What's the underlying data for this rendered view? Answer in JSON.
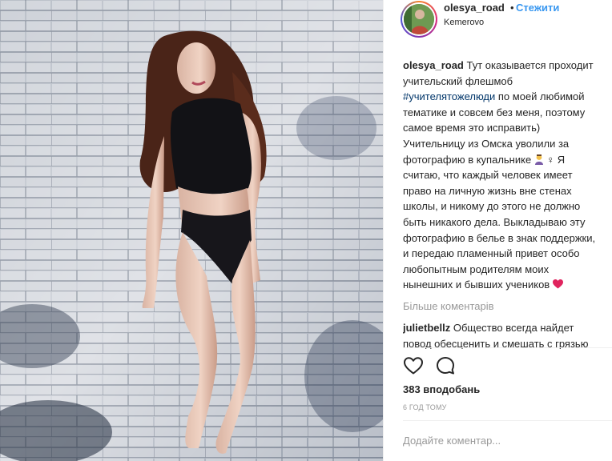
{
  "post": {
    "username": "olesya_road",
    "follow_label": "Стежити",
    "separator": "•",
    "location": "Kemerovo",
    "caption_user": "olesya_road",
    "caption_part1": " Тут оказывается проходит учительский флешмоб ",
    "caption_hashtag": "#учителятожелюди",
    "caption_part2": " по моей любимой тематике и совсем без меня, поэтому самое время это исправить) Учительницу из Омска уволили за фотографию в купальнике ",
    "caption_part3": " Я считаю, что каждый человек имеет право на личную жизнь вне стенах школы, и никому до этого не должно быть никакого дела. Выкладываю эту фотографию в белье в знак поддержки, и передаю пламенный привет особо любопытным родителям моих нынешних и бывших учеников ",
    "more_comments_label": "Більше коментарів",
    "comment_user": "julietbellz",
    "comment_text": " Общество всегда найдет повод обесценить и смешать с грязью профессию учителя. Вы же сейчас этот",
    "likes_label": "383 вподобань",
    "time_label": "6 год тому",
    "add_comment_placeholder": "Додайте коментар..."
  },
  "icons": {
    "like": "heart-outline-icon",
    "comment": "speech-bubble-icon",
    "teacher_emoji": "woman-teacher-emoji",
    "heart_emoji": "red-heart-emoji"
  },
  "colors": {
    "link_blue": "#3897f0",
    "hashtag": "#003569",
    "muted": "#999999",
    "text": "#262626",
    "heart_red": "#e0245e"
  }
}
